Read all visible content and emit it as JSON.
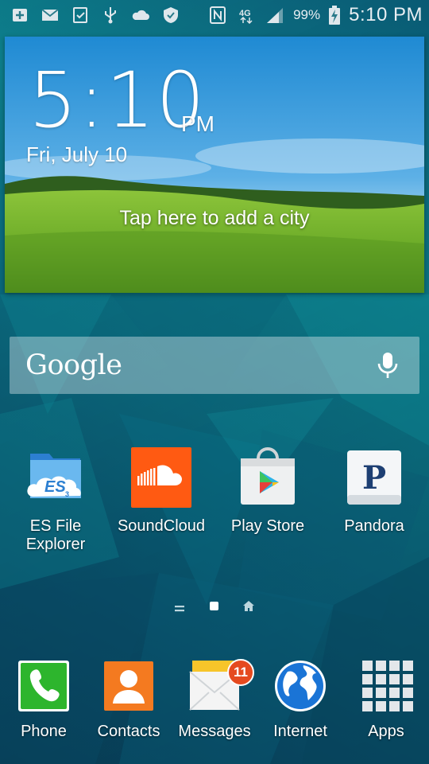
{
  "status_bar": {
    "icons": [
      "add-box-icon",
      "mail-icon",
      "download-done-icon",
      "usb-icon",
      "cloud-icon",
      "shield-icon",
      "nfc-icon",
      "4g-icon",
      "signal-icon"
    ],
    "battery": "99%",
    "time": "5:10 PM"
  },
  "weather": {
    "time": "5:10",
    "ampm": "PM",
    "date": "Fri, July 10",
    "city_prompt": "Tap here to add a city"
  },
  "search": {
    "logo": "Google"
  },
  "apps": [
    {
      "label": "ES File Explorer",
      "label_line1": "ES File",
      "label_line2": "Explorer",
      "icon": "es-file-explorer-icon"
    },
    {
      "label": "SoundCloud",
      "icon": "soundcloud-icon"
    },
    {
      "label": "Play Store",
      "icon": "play-store-icon"
    },
    {
      "label": "Pandora",
      "icon": "pandora-icon"
    }
  ],
  "dock": [
    {
      "label": "Phone",
      "icon": "phone-icon"
    },
    {
      "label": "Contacts",
      "icon": "contacts-icon"
    },
    {
      "label": "Messages",
      "icon": "messages-icon",
      "badge": "11"
    },
    {
      "label": "Internet",
      "icon": "globe-icon"
    },
    {
      "label": "Apps",
      "icon": "apps-grid-icon"
    }
  ],
  "colors": {
    "soundcloud": "#ff5a12",
    "phone": "#2db52d",
    "contacts": "#f47a20",
    "badge": "#e54a1f",
    "internet": "#1a74d6"
  }
}
